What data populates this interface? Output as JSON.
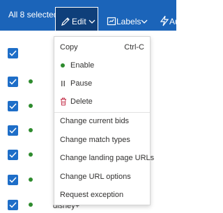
{
  "toolbar": {
    "selection": "All 8 selected",
    "edit_label": "Edit",
    "labels_label": "Labels",
    "partial_label": "Au"
  },
  "menu": {
    "copy": {
      "label": "Copy",
      "shortcut": "Ctrl-C"
    },
    "enable": "Enable",
    "pause": "Pause",
    "delete": "Delete",
    "change_bids": "Change current bids",
    "change_match": "Change match types",
    "change_landing": "Change landing page URLs",
    "change_url_options": "Change URL options",
    "request_exception": "Request exception"
  },
  "grid": {
    "last_row_keyword": "disney+"
  },
  "colors": {
    "toolbar_bg": "#1b64b9",
    "edit_active_bg": "#0f3f7a",
    "checkbox": "#1e6ec8",
    "enabled_dot": "#2e8b2e",
    "delete_icon": "#c4314b"
  }
}
